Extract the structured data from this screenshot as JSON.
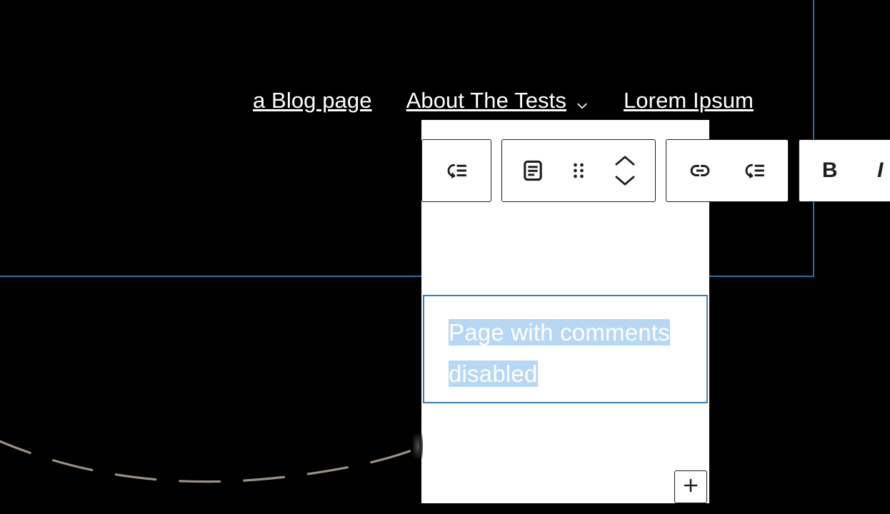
{
  "theme": {
    "canvas_background": "#000000",
    "panel_background": "#ffffff",
    "nav_text_color": "#ffffff",
    "guide_line_color": "#2f6ea5",
    "block_selected_border": "#3a7fb8",
    "text_selection_background": "#b7d7f7",
    "toolbar_border_color": "#1e1e1e",
    "decor_line_color": "#9a9186"
  },
  "site_nav": {
    "items": [
      {
        "label": "a Blog page",
        "has_submenu": false,
        "caret_icon": ""
      },
      {
        "label": "About The Tests",
        "has_submenu": true,
        "caret_icon": "chevron-down-icon"
      },
      {
        "label": "Lorem Ipsum",
        "has_submenu": false,
        "caret_icon": ""
      }
    ]
  },
  "block_toolbar": {
    "groups": [
      {
        "name": "transform",
        "buttons": [
          {
            "icon": "change-block-type-icon",
            "label": ""
          }
        ]
      },
      {
        "name": "block",
        "buttons": [
          {
            "icon": "paragraph-block-icon",
            "label": ""
          },
          {
            "icon": "drag-handle-icon",
            "label": ""
          },
          {
            "icon": "move-up-down-icon",
            "label": ""
          }
        ]
      },
      {
        "name": "format",
        "buttons": [
          {
            "icon": "link-icon",
            "label": ""
          },
          {
            "icon": "footnote-icon",
            "label": ""
          }
        ]
      },
      {
        "name": "textstyle",
        "buttons": [
          {
            "icon": "bold-icon",
            "label": "B"
          },
          {
            "icon": "italic-icon",
            "label": "I"
          }
        ]
      }
    ]
  },
  "editor": {
    "selected_block": {
      "type": "paragraph",
      "text": "Page with comments disabled",
      "is_selected": true,
      "text_is_highlighted": true
    },
    "appender": {
      "icon": "plus-icon",
      "label": ""
    }
  }
}
